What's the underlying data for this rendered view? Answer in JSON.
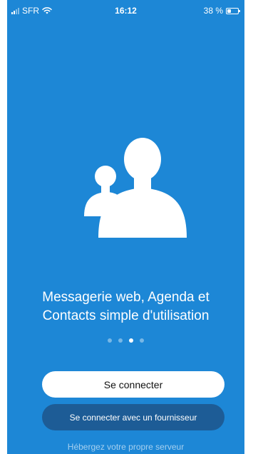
{
  "status": {
    "carrier": "SFR",
    "time": "16:12",
    "battery_label": "38 %",
    "battery_level": 0.38,
    "signal_bars": 2
  },
  "onboarding": {
    "illustration_icon": "contacts-people-icon",
    "tagline_line1": "Messagerie web, Agenda et",
    "tagline_line2": "Contacts simple d'utilisation",
    "page_count": 4,
    "active_page": 3
  },
  "actions": {
    "login_label": "Se connecter",
    "provider_login_label": "Se connecter avec un fournisseur",
    "host_link_label": "Hébergez votre propre serveur"
  },
  "colors": {
    "background": "#1d87d6",
    "secondary_button": "#1d5c96"
  }
}
